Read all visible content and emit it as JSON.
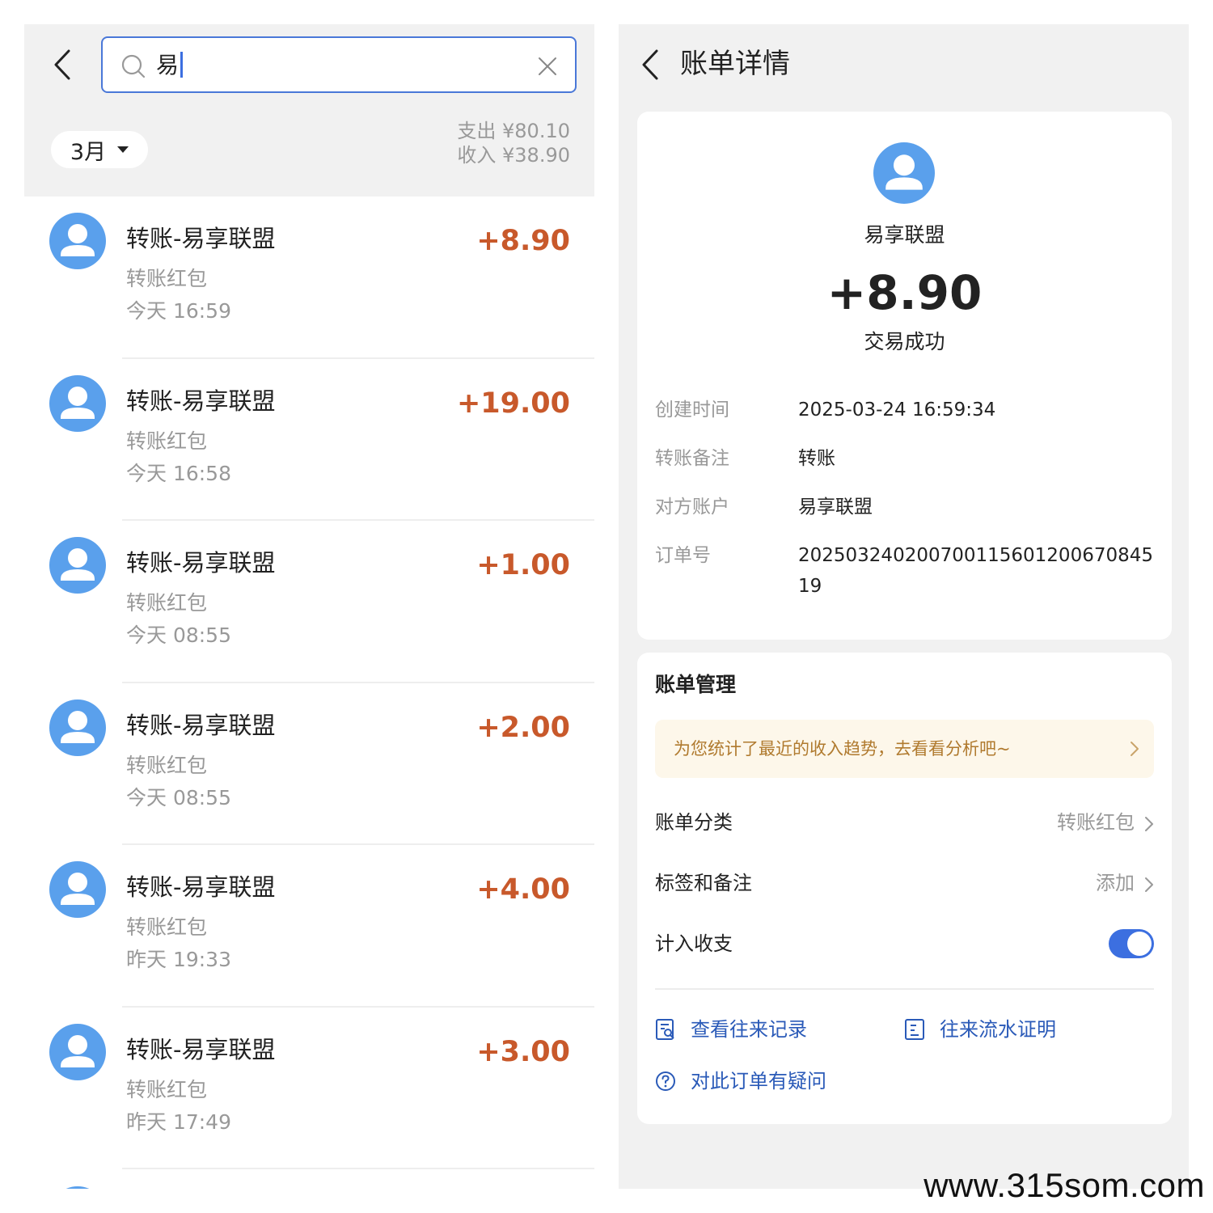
{
  "search": {
    "query": "易"
  },
  "filter": {
    "month": "3月"
  },
  "summary": {
    "expense": "支出 ¥80.10",
    "income": "收入 ¥38.90"
  },
  "transactions": [
    {
      "title": "转账-易享联盟",
      "category": "转账红包",
      "time": "今天 16:59",
      "amount": "+8.90"
    },
    {
      "title": "转账-易享联盟",
      "category": "转账红包",
      "time": "今天 16:58",
      "amount": "+19.00"
    },
    {
      "title": "转账-易享联盟",
      "category": "转账红包",
      "time": "今天 08:55",
      "amount": "+1.00"
    },
    {
      "title": "转账-易享联盟",
      "category": "转账红包",
      "time": "今天 08:55",
      "amount": "+2.00"
    },
    {
      "title": "转账-易享联盟",
      "category": "转账红包",
      "time": "昨天 19:33",
      "amount": "+4.00"
    },
    {
      "title": "转账-易享联盟",
      "category": "转账红包",
      "time": "昨天 17:49",
      "amount": "+3.00"
    }
  ],
  "detail": {
    "page_title": "账单详情",
    "party": "易享联盟",
    "amount": "+8.90",
    "status": "交易成功",
    "rows": [
      {
        "label": "创建时间",
        "value": "2025-03-24 16:59:34"
      },
      {
        "label": "转账备注",
        "value": "转账"
      },
      {
        "label": "对方账户",
        "value": "易享联盟"
      },
      {
        "label": "订单号",
        "value": "20250324020070011560120067084519"
      }
    ]
  },
  "management": {
    "title": "账单管理",
    "tip": "为您统计了最近的收入趋势，去看看分析吧~",
    "rows": [
      {
        "label": "账单分类",
        "value": "转账红包"
      },
      {
        "label": "标签和备注",
        "value": "添加"
      },
      {
        "label": "计入收支",
        "toggle_on": true
      }
    ],
    "links": {
      "records": "查看往来记录",
      "proof": "往来流水证明",
      "question": "对此订单有疑问"
    }
  },
  "watermark": "www.315som.com",
  "colors": {
    "accent": "#3c6fe0",
    "amount": "#c8592b",
    "avatar": "#5aa0ec",
    "tip_bg": "#fdf7ea",
    "tip_text": "#b07a2e"
  }
}
